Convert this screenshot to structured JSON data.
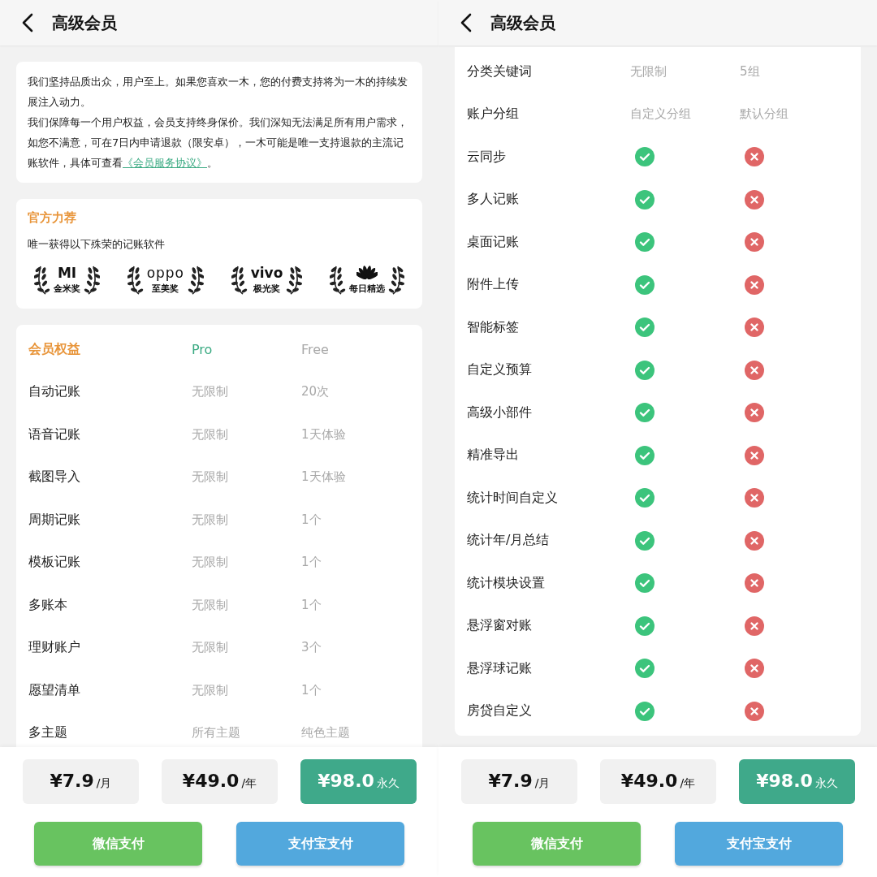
{
  "screens": [
    {
      "title": "高级会员",
      "intro": {
        "paragraphs": [
          {
            "text": "我们坚持品质出众，用户至上。如果您喜欢一木，您的付费支持将为一木的持续发展注入动力。"
          },
          {
            "text": "我们保障每一个用户权益，会员支持终身保价。我们深知无法满足所有用户需求，如您不满意，可在7日内申请退款（限安卓），一木可能是唯一支持退款的主流记账软件，具体可查看",
            "link": "《会员服务协议》",
            "after": "。"
          }
        ]
      },
      "recommend": {
        "title": "官方力荐",
        "subtitle": "唯一获得以下殊荣的记账软件",
        "awards": [
          {
            "kind": "mi",
            "logo": "MI",
            "label": "金米奖"
          },
          {
            "kind": "oppo",
            "logo": "oppo",
            "label": "至美奖"
          },
          {
            "kind": "vivo",
            "logo": "vivo",
            "label": "极光奖"
          },
          {
            "kind": "huawei",
            "label": "每日精选"
          }
        ]
      },
      "table": {
        "header": {
          "feature": "会员权益",
          "pro": "Pro",
          "free": "Free"
        },
        "rows": [
          {
            "feature": "自动记账",
            "pro": {
              "kind": "text",
              "text": "无限制"
            },
            "free": {
              "kind": "text",
              "text": "20次"
            }
          },
          {
            "feature": "语音记账",
            "pro": {
              "kind": "text",
              "text": "无限制"
            },
            "free": {
              "kind": "text",
              "text": "1天体验"
            }
          },
          {
            "feature": "截图导入",
            "pro": {
              "kind": "text",
              "text": "无限制"
            },
            "free": {
              "kind": "text",
              "text": "1天体验"
            }
          },
          {
            "feature": "周期记账",
            "pro": {
              "kind": "text",
              "text": "无限制"
            },
            "free": {
              "kind": "text",
              "text": "1个"
            }
          },
          {
            "feature": "模板记账",
            "pro": {
              "kind": "text",
              "text": "无限制"
            },
            "free": {
              "kind": "text",
              "text": "1个"
            }
          },
          {
            "feature": "多账本",
            "pro": {
              "kind": "text",
              "text": "无限制"
            },
            "free": {
              "kind": "text",
              "text": "1个"
            }
          },
          {
            "feature": "理财账户",
            "pro": {
              "kind": "text",
              "text": "无限制"
            },
            "free": {
              "kind": "text",
              "text": "3个"
            }
          },
          {
            "feature": "愿望清单",
            "pro": {
              "kind": "text",
              "text": "无限制"
            },
            "free": {
              "kind": "text",
              "text": "1个"
            }
          },
          {
            "feature": "多主题",
            "pro": {
              "kind": "text",
              "text": "所有主题"
            },
            "free": {
              "kind": "text",
              "text": "纯色主题"
            }
          }
        ]
      },
      "prices": [
        {
          "amount": "¥7.9",
          "unit": "/月",
          "selected": false
        },
        {
          "amount": "¥49.0",
          "unit": "/年",
          "selected": false
        },
        {
          "amount": "¥98.0",
          "unit": "永久",
          "selected": true
        }
      ],
      "payments": [
        {
          "label": "微信支付",
          "color": "#68c360"
        },
        {
          "label": "支付宝支付",
          "color": "#52a8dd"
        }
      ]
    },
    {
      "title": "高级会员",
      "table": {
        "rows": [
          {
            "feature": "分类关键词",
            "pro": {
              "kind": "text",
              "text": "无限制"
            },
            "free": {
              "kind": "text",
              "text": "5组"
            }
          },
          {
            "feature": "账户分组",
            "pro": {
              "kind": "text",
              "text": "自定义分组"
            },
            "free": {
              "kind": "text",
              "text": "默认分组"
            }
          },
          {
            "feature": "云同步",
            "pro": {
              "kind": "mark",
              "included": true
            },
            "free": {
              "kind": "mark",
              "included": false
            }
          },
          {
            "feature": "多人记账",
            "pro": {
              "kind": "mark",
              "included": true
            },
            "free": {
              "kind": "mark",
              "included": false
            }
          },
          {
            "feature": "桌面记账",
            "pro": {
              "kind": "mark",
              "included": true
            },
            "free": {
              "kind": "mark",
              "included": false
            }
          },
          {
            "feature": "附件上传",
            "pro": {
              "kind": "mark",
              "included": true
            },
            "free": {
              "kind": "mark",
              "included": false
            }
          },
          {
            "feature": "智能标签",
            "pro": {
              "kind": "mark",
              "included": true
            },
            "free": {
              "kind": "mark",
              "included": false
            }
          },
          {
            "feature": "自定义预算",
            "pro": {
              "kind": "mark",
              "included": true
            },
            "free": {
              "kind": "mark",
              "included": false
            }
          },
          {
            "feature": "高级小部件",
            "pro": {
              "kind": "mark",
              "included": true
            },
            "free": {
              "kind": "mark",
              "included": false
            }
          },
          {
            "feature": "精准导出",
            "pro": {
              "kind": "mark",
              "included": true
            },
            "free": {
              "kind": "mark",
              "included": false
            }
          },
          {
            "feature": "统计时间自定义",
            "pro": {
              "kind": "mark",
              "included": true
            },
            "free": {
              "kind": "mark",
              "included": false
            }
          },
          {
            "feature": "统计年/月总结",
            "pro": {
              "kind": "mark",
              "included": true
            },
            "free": {
              "kind": "mark",
              "included": false
            }
          },
          {
            "feature": "统计模块设置",
            "pro": {
              "kind": "mark",
              "included": true
            },
            "free": {
              "kind": "mark",
              "included": false
            }
          },
          {
            "feature": "悬浮窗对账",
            "pro": {
              "kind": "mark",
              "included": true
            },
            "free": {
              "kind": "mark",
              "included": false
            }
          },
          {
            "feature": "悬浮球记账",
            "pro": {
              "kind": "mark",
              "included": true
            },
            "free": {
              "kind": "mark",
              "included": false
            }
          },
          {
            "feature": "房贷自定义",
            "pro": {
              "kind": "mark",
              "included": true
            },
            "free": {
              "kind": "mark",
              "included": false
            }
          }
        ]
      },
      "prices": [
        {
          "amount": "¥7.9",
          "unit": "/月",
          "selected": false
        },
        {
          "amount": "¥49.0",
          "unit": "/年",
          "selected": false
        },
        {
          "amount": "¥98.0",
          "unit": "永久",
          "selected": true
        }
      ],
      "payments": [
        {
          "label": "微信支付",
          "color": "#68c360"
        },
        {
          "label": "支付宝支付",
          "color": "#52a8dd"
        }
      ]
    }
  ]
}
